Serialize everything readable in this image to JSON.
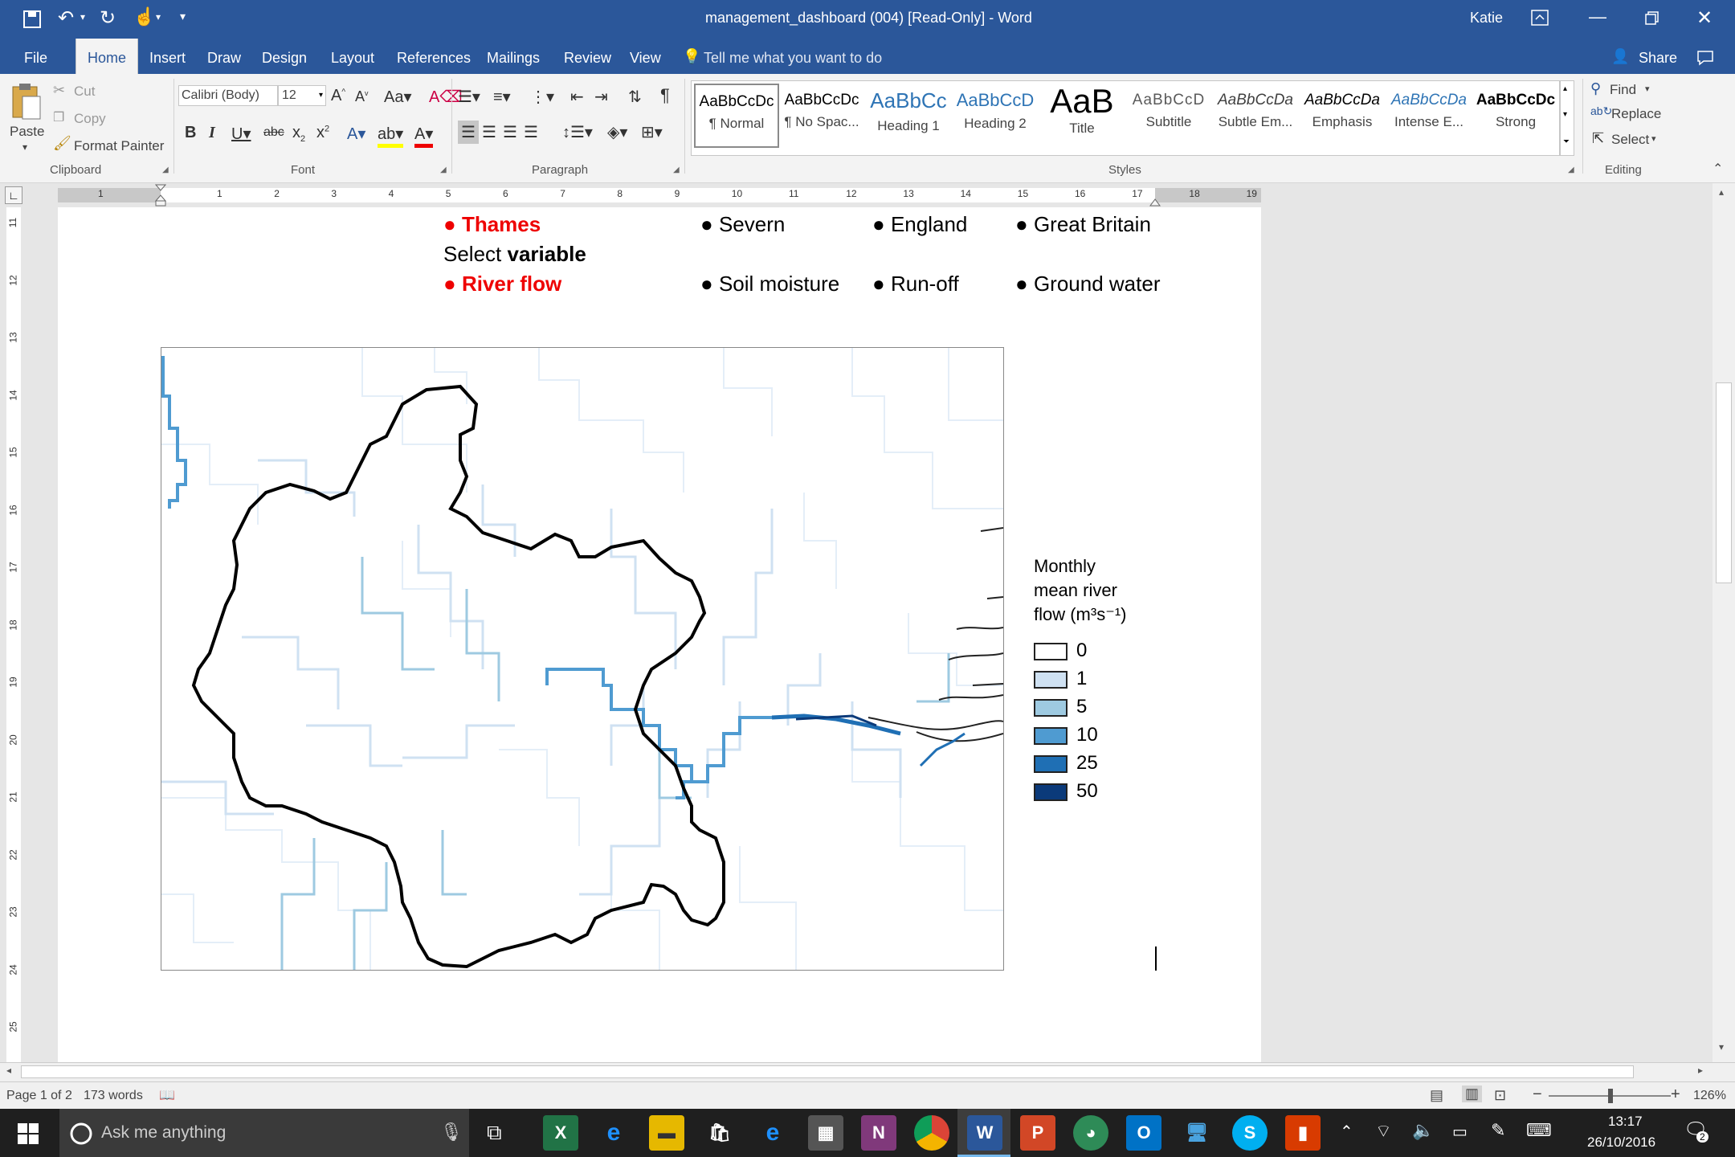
{
  "window": {
    "title": "management_dashboard (004) [Read-Only] - Word",
    "user": "Katie",
    "qat_customize": "▾"
  },
  "tabs": [
    "File",
    "Home",
    "Insert",
    "Draw",
    "Design",
    "Layout",
    "References",
    "Mailings",
    "Review",
    "View"
  ],
  "tell_me": "Tell me what you want to do",
  "share": "Share",
  "clipboard": {
    "paste": "Paste",
    "cut": "Cut",
    "copy": "Copy",
    "format_painter": "Format Painter",
    "label": "Clipboard"
  },
  "font": {
    "name": "Calibri (Body)",
    "size": "12",
    "label": "Font"
  },
  "paragraph": {
    "label": "Paragraph"
  },
  "styles": {
    "label": "Styles",
    "items": [
      {
        "sample": "AaBbCcDc",
        "name": "¶ Normal"
      },
      {
        "sample": "AaBbCcDc",
        "name": "¶ No Spac..."
      },
      {
        "sample": "AaBbCc",
        "name": "Heading 1"
      },
      {
        "sample": "AaBbCcD",
        "name": "Heading 2"
      },
      {
        "sample": "AaB",
        "name": "Title"
      },
      {
        "sample": "AaBbCcD",
        "name": "Subtitle"
      },
      {
        "sample": "AaBbCcDa",
        "name": "Subtle Em..."
      },
      {
        "sample": "AaBbCcDa",
        "name": "Emphasis"
      },
      {
        "sample": "AaBbCcDa",
        "name": "Intense E..."
      },
      {
        "sample": "AaBbCcDc",
        "name": "Strong"
      }
    ]
  },
  "editing": {
    "find": "Find",
    "replace": "Replace",
    "select": "Select",
    "label": "Editing"
  },
  "ruler": {
    "h_left": [
      "1"
    ],
    "h": [
      "1",
      "2",
      "3",
      "4",
      "5",
      "6",
      "7",
      "8",
      "9",
      "10",
      "11",
      "12",
      "13",
      "14",
      "15",
      "16",
      "17",
      "18",
      "19"
    ],
    "v": [
      "11",
      "12",
      "13",
      "14",
      "15",
      "16",
      "17",
      "18",
      "19",
      "20",
      "21",
      "22",
      "23",
      "24",
      "25"
    ]
  },
  "document": {
    "row1": [
      "Thames",
      "Severn",
      "England",
      "Great Britain"
    ],
    "select_prefix": "Select ",
    "select_bold": "variable",
    "row2": [
      "River flow",
      "Soil moisture",
      "Run-off",
      "Ground water"
    ],
    "bullet": "●"
  },
  "legend": {
    "title_lines": [
      "Monthly",
      "mean river",
      "flow (m³s⁻¹)"
    ],
    "items": [
      {
        "label": "0",
        "color": "#ffffff"
      },
      {
        "label": "1",
        "color": "#cfe1f2"
      },
      {
        "label": "5",
        "color": "#9ecae1"
      },
      {
        "label": "10",
        "color": "#4f9bd1"
      },
      {
        "label": "25",
        "color": "#1f6fb4"
      },
      {
        "label": "50",
        "color": "#0b3a7a"
      }
    ]
  },
  "status": {
    "page": "Page 1 of 2",
    "words": "173 words",
    "zoom": "126%"
  },
  "taskbar": {
    "search": "Ask me anything",
    "time": "13:17",
    "date": "26/10/2016",
    "notifications": "2"
  }
}
